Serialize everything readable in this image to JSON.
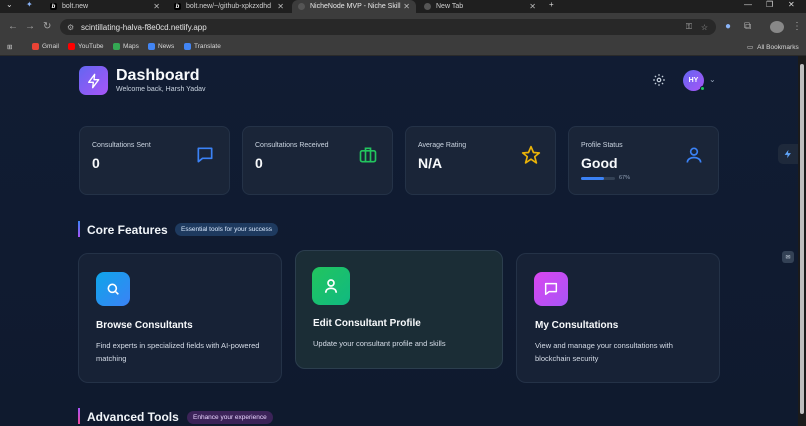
{
  "browser": {
    "tabs": [
      {
        "label": "bolt.new",
        "favicon": "b"
      },
      {
        "label": "bolt.new/~/github-xpkzxdhd",
        "favicon": "b"
      },
      {
        "label": "NicheNode MVP - Niche Skill ",
        "favicon": "globe"
      },
      {
        "label": "New Tab",
        "favicon": "globe"
      }
    ],
    "url": "scintillating-halva-f8e0cd.netlify.app",
    "bookmarks": [
      "Gmail",
      "YouTube",
      "Maps",
      "News",
      "Translate"
    ],
    "all_bookmarks": "All Bookmarks"
  },
  "header": {
    "title": "Dashboard",
    "subtitle": "Welcome back, Harsh Yadav",
    "avatar_initials": "HY"
  },
  "stats": [
    {
      "label": "Consultations Sent",
      "value": "0",
      "icon": "message-icon",
      "color": "#3b82f6"
    },
    {
      "label": "Consultations Received",
      "value": "0",
      "icon": "briefcase-icon",
      "color": "#22c55e"
    },
    {
      "label": "Average Rating",
      "value": "N/A",
      "icon": "star-icon",
      "color": "#eab308"
    },
    {
      "label": "Profile Status",
      "value": "Good",
      "icon": "user-icon",
      "color": "#3b82f6",
      "progress": 0.67,
      "progress_label": "67%"
    }
  ],
  "core": {
    "title": "Core Features",
    "badge": "Essential tools for your success",
    "cards": [
      {
        "title": "Browse Consultants",
        "desc": "Find experts in specialized fields with AI-powered matching",
        "icon": "search-icon",
        "color": "#0ea5e9"
      },
      {
        "title": "Edit Consultant Profile",
        "desc": "Update your consultant profile and skills",
        "icon": "user-icon",
        "color": "#22c55e"
      },
      {
        "title": "My Consultations",
        "desc": "View and manage your consultations with blockchain security",
        "icon": "message-icon",
        "color": "#d946ef"
      }
    ]
  },
  "advanced": {
    "title": "Advanced Tools",
    "badge": "Enhance your experience"
  }
}
